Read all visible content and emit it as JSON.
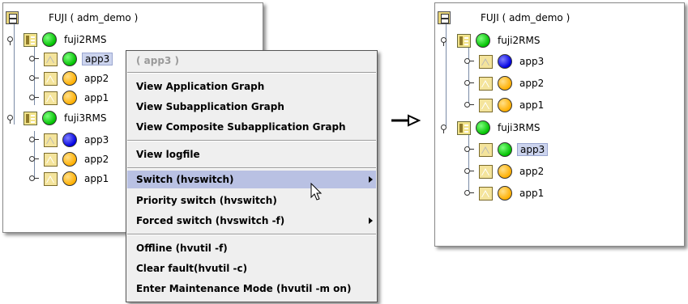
{
  "left_tree": {
    "root_label": "FUJI ( adm_demo )",
    "systems": [
      {
        "label": "fuji2RMS",
        "status": "green",
        "apps": [
          {
            "label": "app3",
            "status": "green",
            "selected": true
          },
          {
            "label": "app2",
            "status": "orange"
          },
          {
            "label": "app1",
            "status": "orange"
          }
        ]
      },
      {
        "label": "fuji3RMS",
        "status": "green",
        "apps": [
          {
            "label": "app3",
            "status": "blue"
          },
          {
            "label": "app2",
            "status": "orange"
          },
          {
            "label": "app1",
            "status": "orange"
          }
        ]
      }
    ]
  },
  "context_menu": {
    "header": "( app3 )",
    "items": [
      "View Application Graph",
      "View Subapplication Graph",
      "View Composite Subapplication Graph",
      "View logfile",
      "Switch (hvswitch)",
      "Priority switch (hvswitch)",
      "Forced switch (hvswitch -f)",
      "Offline (hvutil -f)",
      "Clear fault(hvutil -c)",
      "Enter Maintenance Mode (hvutil -m on)"
    ]
  },
  "right_tree": {
    "root_label": "FUJI ( adm_demo )",
    "systems": [
      {
        "label": "fuji2RMS",
        "status": "green",
        "apps": [
          {
            "label": "app3",
            "status": "blue"
          },
          {
            "label": "app2",
            "status": "orange"
          },
          {
            "label": "app1",
            "status": "orange"
          }
        ]
      },
      {
        "label": "fuji3RMS",
        "status": "green",
        "apps": [
          {
            "label": "app3",
            "status": "green",
            "selected": true
          },
          {
            "label": "app2",
            "status": "orange"
          },
          {
            "label": "app1",
            "status": "orange"
          }
        ]
      }
    ]
  },
  "colors": {
    "status_green": "#00c000",
    "status_orange": "#ffae00",
    "status_blue": "#0000e0",
    "selection": "#ccd4ee",
    "menu_hover": "#b9c1e3"
  },
  "icons": {
    "root": "cluster-icon",
    "system": "system-node-icon",
    "app": "application-icon",
    "handle": "tree-expand-handle-icon",
    "cursor": "mouse-pointer-icon",
    "transition": "right-arrow-icon"
  }
}
